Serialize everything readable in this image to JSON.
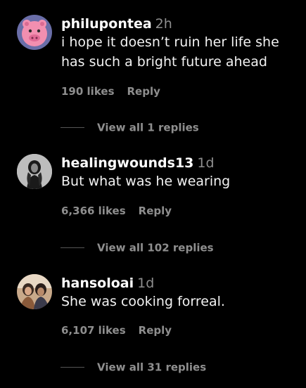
{
  "colors": {
    "background": "#000000",
    "username": "#ffffff",
    "secondary_text": "#8e8e8e"
  },
  "comments": [
    {
      "username": "philupontea",
      "time": "2h",
      "text": "i hope it doesn’t ruin her life she has such a bright future ahead",
      "likes": "190 likes",
      "reply_label": "Reply",
      "view_replies": "View all 1 replies",
      "avatar_icon": "pink-cartoon-pig-avatar"
    },
    {
      "username": "healingwounds13",
      "time": "1d",
      "text": "But what was he wearing",
      "likes": "6,366 likes",
      "reply_label": "Reply",
      "view_replies": "View all 102 replies",
      "avatar_icon": "monochrome-portrait-avatar"
    },
    {
      "username": "hansoloai",
      "time": "1d",
      "text": "She was cooking forreal.",
      "likes": "6,107 likes",
      "reply_label": "Reply",
      "view_replies": "View all 31 replies",
      "avatar_icon": "couple-photo-avatar"
    }
  ]
}
